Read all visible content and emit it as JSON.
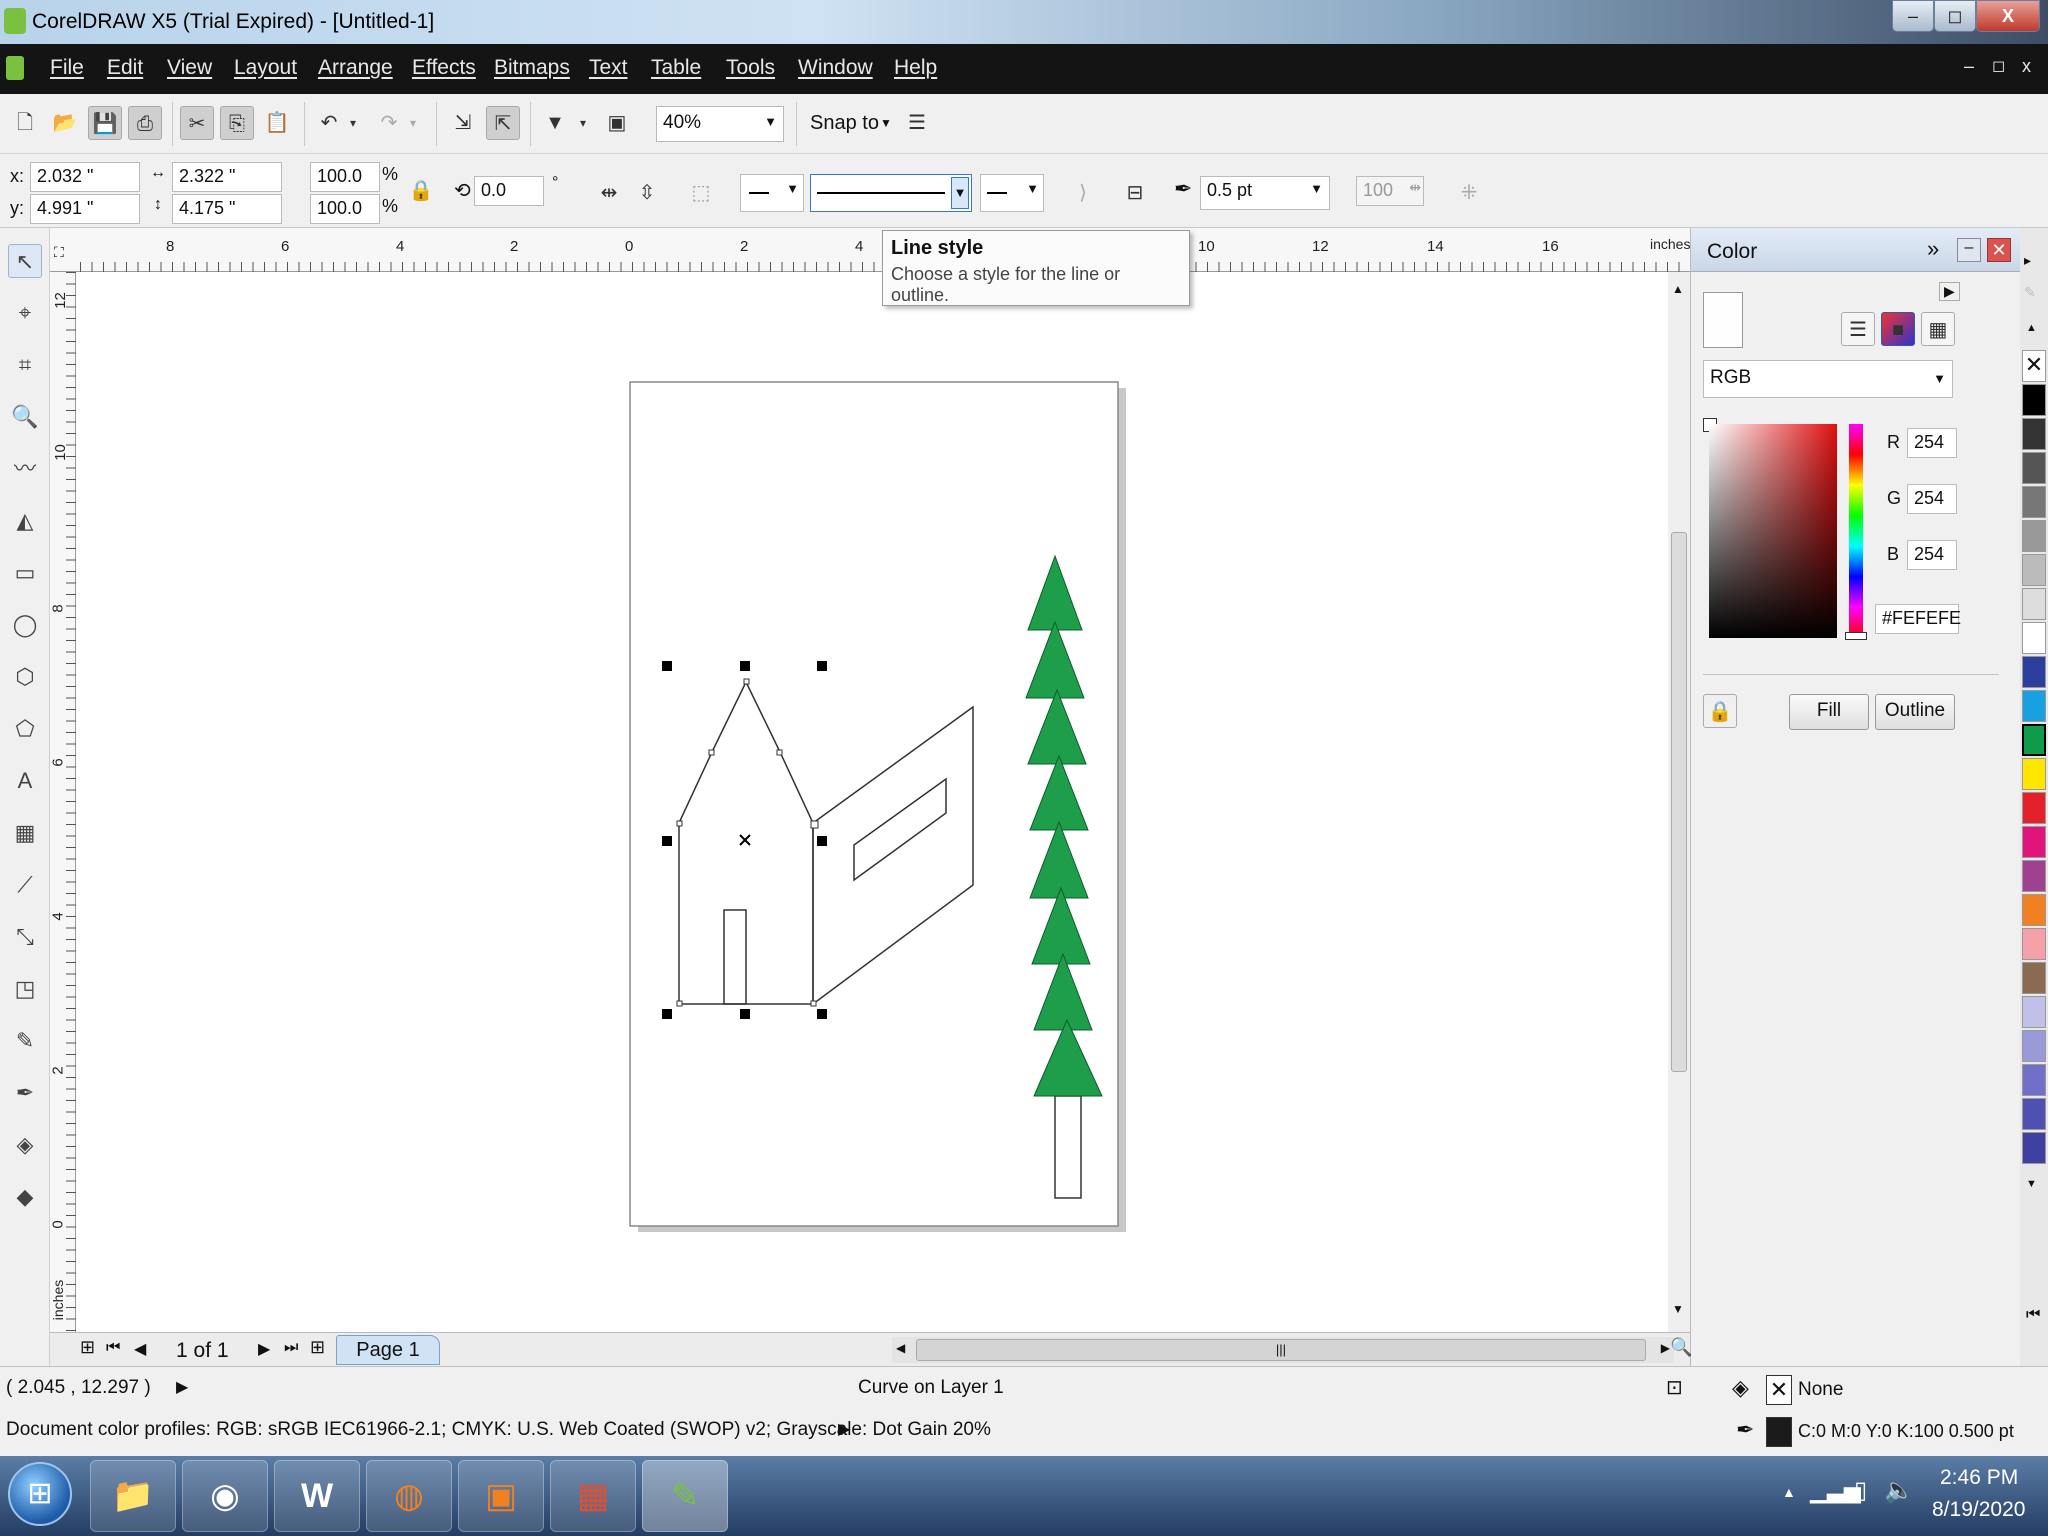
{
  "window": {
    "title": "CorelDRAW X5 (Trial Expired) - [Untitled-1]",
    "min": "–",
    "max": "◻",
    "close": "X"
  },
  "menu": [
    "File",
    "Edit",
    "View",
    "Layout",
    "Arrange",
    "Effects",
    "Bitmaps",
    "Text",
    "Table",
    "Tools",
    "Window",
    "Help"
  ],
  "toolbar": {
    "zoom": "40%",
    "snap": "Snap to"
  },
  "props": {
    "x": "2.032 \"",
    "y": "4.991 \"",
    "w": "2.322 \"",
    "h": "4.175 \"",
    "scale_w": "100.0",
    "scale_h": "100.0",
    "pct": "%",
    "rotation": "0.0",
    "deg": "°",
    "outline_width": "0.5 pt",
    "percent_100": "100"
  },
  "tooltip": {
    "title": "Line style",
    "text": "Choose a style for the line or outline."
  },
  "ruler": {
    "h_units": "inches",
    "v_units": "inches",
    "h_ticks": [
      "8",
      "6",
      "4",
      "2",
      "0",
      "2",
      "4",
      "10",
      "12",
      "14",
      "16"
    ],
    "v_ticks": [
      "12",
      "10",
      "8",
      "6",
      "4",
      "2",
      "0"
    ]
  },
  "color_panel": {
    "title": "Color",
    "model": "RGB",
    "r_label": "R",
    "g_label": "G",
    "b_label": "B",
    "r": "254",
    "g": "254",
    "b": "254",
    "hex": "#FEFEFE",
    "fill": "Fill",
    "outline": "Outline"
  },
  "pagebar": {
    "count": "1 of 1",
    "tab": "Page 1"
  },
  "status": {
    "coords": "( 2.045 , 12.297 )",
    "object": "Curve on Layer 1",
    "profiles": "Document color profiles: RGB: sRGB IEC61966-2.1; CMYK: U.S. Web Coated (SWOP) v2; Grayscale: Dot Gain 20%",
    "fill_value": "None",
    "outline_value": "C:0 M:0 Y:0 K:100  0.500 pt"
  },
  "taskbar": {
    "time": "2:46 PM",
    "date": "8/19/2020"
  },
  "colors": {
    "tree_green": "#1e9e4a",
    "accent": "#2b5fa5"
  }
}
